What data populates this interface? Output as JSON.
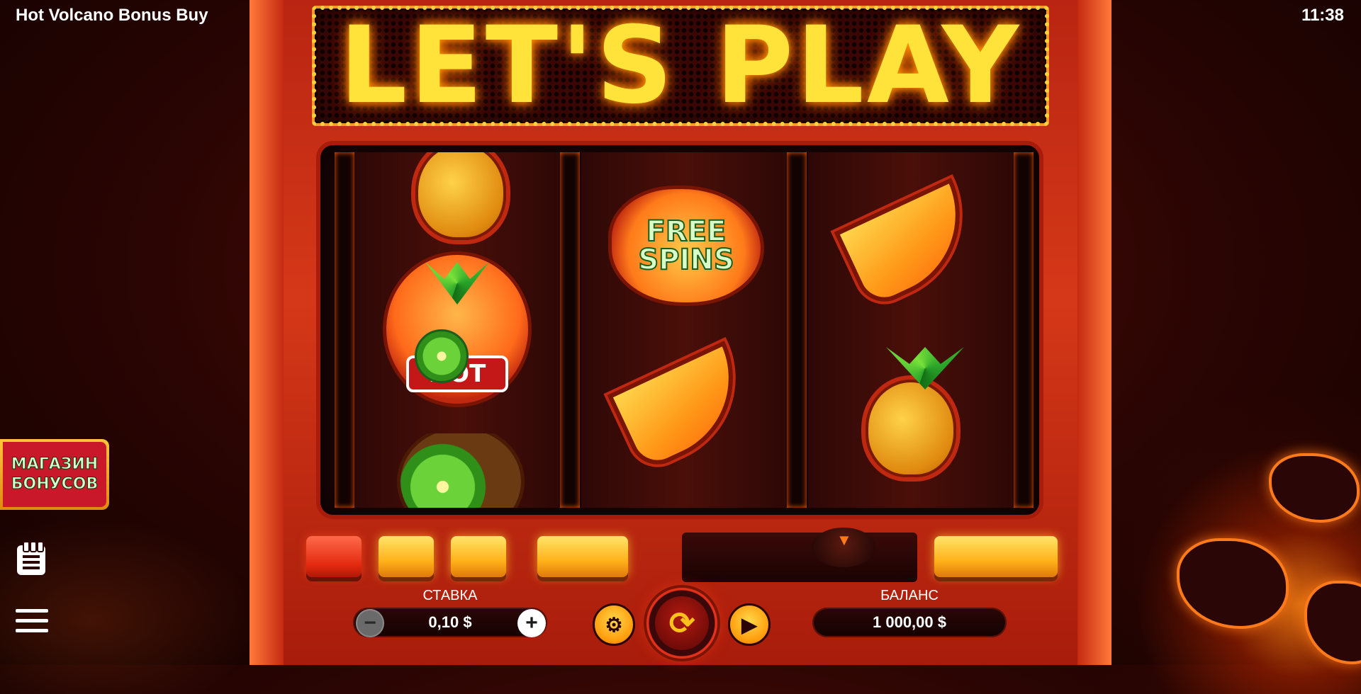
{
  "header": {
    "title": "Hot Volcano Bonus Buy",
    "clock": "11:38"
  },
  "marquee": {
    "text": "LET'S PLAY"
  },
  "reels": [
    {
      "symbols": [
        "pineapple-icon",
        "hot-fruits-icon",
        "kiwi-icon"
      ]
    },
    {
      "symbols": [
        "free-spins-icon",
        "banana-icon"
      ]
    },
    {
      "symbols": [
        "banana-icon",
        "pineapple-icon"
      ]
    }
  ],
  "symbols_text": {
    "free": "FREE",
    "spins": "SPINS",
    "hot": "HOT"
  },
  "bonus_shop": {
    "line1": "МАГАЗИН",
    "line2": "БОНУСОВ"
  },
  "stake": {
    "label": "СТАВКА",
    "value": "0,10 $",
    "minus": "−",
    "plus": "+"
  },
  "balance": {
    "label": "БАЛАНС",
    "value": "1 000,00 $"
  },
  "controls": {
    "spin_icon": "⟳",
    "coins_icon": "⚙",
    "autoplay_icon": "▶"
  },
  "colors": {
    "accent": "#ffd23a",
    "cabinet": "#d53818",
    "background": "#2a0503"
  }
}
